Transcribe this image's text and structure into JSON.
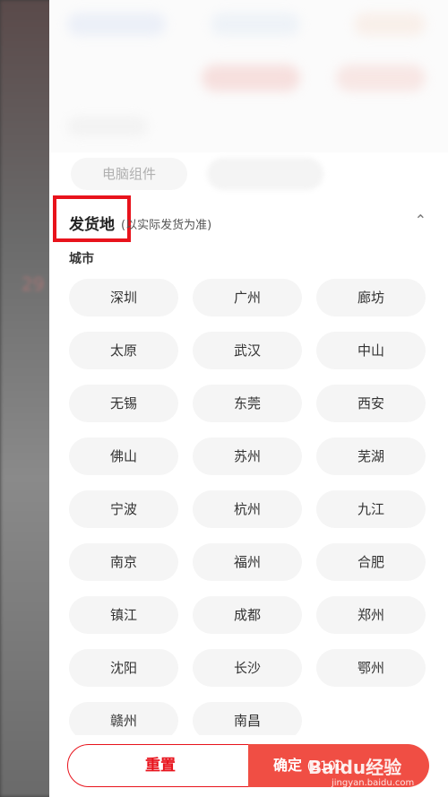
{
  "background": {
    "price_fragment": "29"
  },
  "filters": {
    "faded_chip": "电脑组件"
  },
  "ship_from": {
    "title": "发货地",
    "note": "(以实际发货为准)",
    "collapse_icon": "chevron-up-icon",
    "city_label": "城市",
    "cities": [
      "深圳",
      "广州",
      "廊坊",
      "太原",
      "武汉",
      "中山",
      "无锡",
      "东莞",
      "西安",
      "佛山",
      "苏州",
      "芜湖",
      "宁波",
      "杭州",
      "九江",
      "南京",
      "福州",
      "合肥",
      "镇江",
      "成都",
      "郑州",
      "沈阳",
      "长沙",
      "鄂州",
      "赣州",
      "南昌"
    ]
  },
  "footer": {
    "reset_label": "重置",
    "confirm_label": "确定",
    "confirm_count": "(2100"
  },
  "watermark": {
    "main": "Baidu经验",
    "sub": "jingyan.baidu.com"
  },
  "colors": {
    "accent": "#e8131c",
    "confirm_bg": "#f04e44",
    "chip_bg": "#f5f5f5"
  }
}
